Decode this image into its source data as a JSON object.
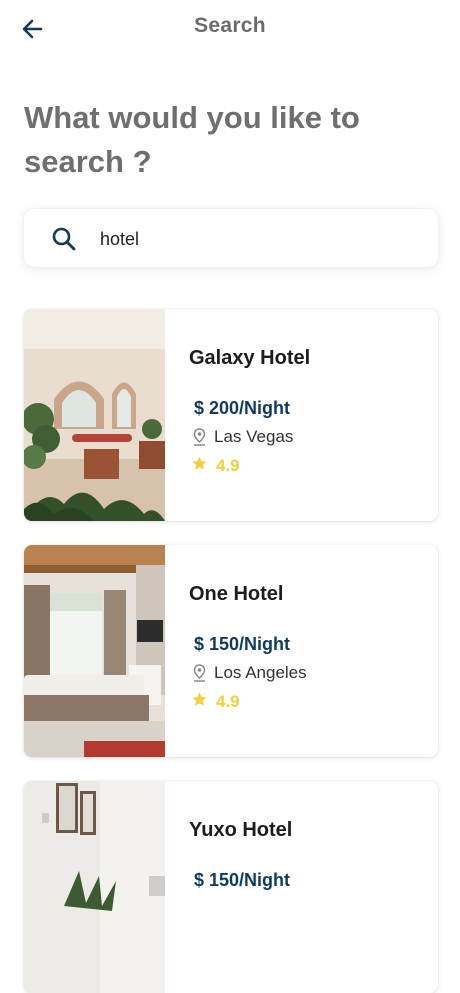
{
  "header": {
    "title": "Search"
  },
  "headline": "What would you like to search ?",
  "search": {
    "value": "hotel",
    "placeholder": ""
  },
  "results": [
    {
      "name": "Galaxy Hotel",
      "price": "$ 200/Night",
      "location": "Las Vegas",
      "rating": "4.9"
    },
    {
      "name": "One Hotel",
      "price": "$ 150/Night",
      "location": "Los Angeles",
      "rating": "4.9"
    },
    {
      "name": "Yuxo Hotel",
      "price": "$ 150/Night",
      "location": "",
      "rating": ""
    }
  ],
  "colors": {
    "price": "#0f3b5f",
    "star": "#f2d03b",
    "muted_heading": "#6f6f6f"
  },
  "icons": {
    "back": "arrow-left-icon",
    "search": "search-icon",
    "location": "location-pin-icon",
    "rating": "star-icon"
  }
}
